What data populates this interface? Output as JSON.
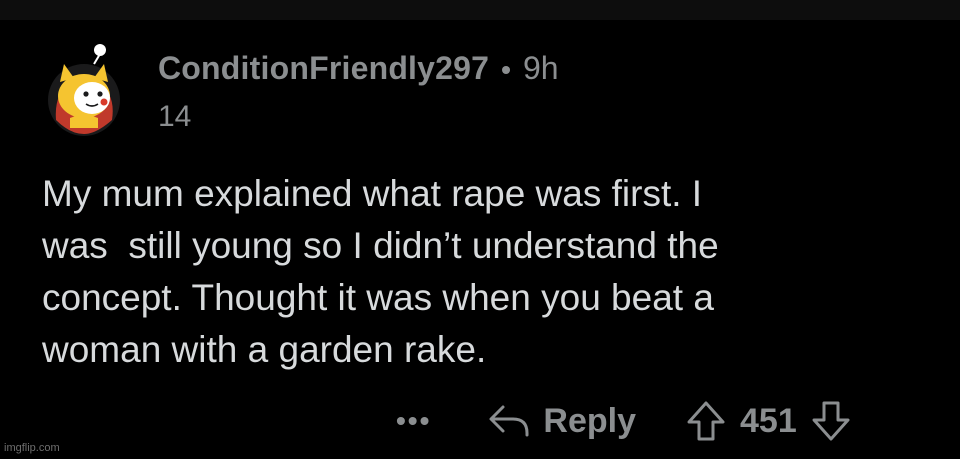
{
  "comment": {
    "username": "ConditionFriendly297",
    "separator": "•",
    "age": "9h",
    "karma": "14",
    "body": "My mum explained what rape was first. I\nwas  still young so I didn’t understand the\nconcept. Thought it was when you beat a\nwoman with a garden rake.",
    "actions": {
      "more_label": "•••",
      "reply_label": "Reply",
      "vote_count": "451"
    }
  },
  "watermark": "imgflip.com",
  "colors": {
    "background": "#000000",
    "meta_text": "#8b8e90",
    "body_text": "#d7dadc",
    "avatar_bg": "#ffffff",
    "avatar_yellow": "#f5c430"
  },
  "icons": {
    "avatar": "snoo-shiba-avatar",
    "reply": "reply-arrow-icon",
    "upvote": "upvote-arrow-icon",
    "downvote": "downvote-arrow-icon",
    "more": "more-dots-icon"
  }
}
